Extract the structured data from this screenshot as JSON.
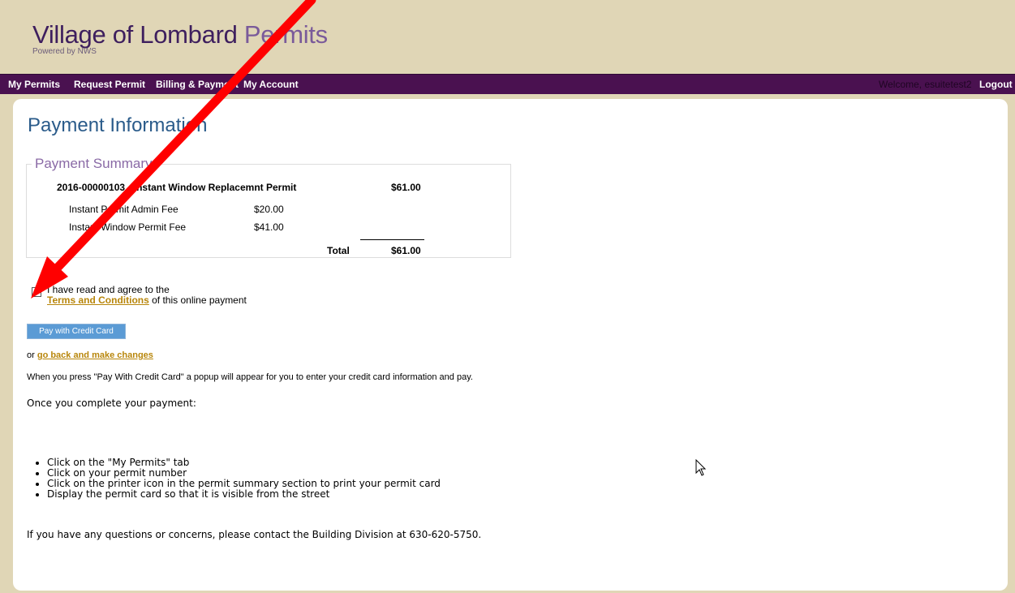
{
  "brand": {
    "title_main": "Village of Lombard",
    "title_accent": "Permits",
    "subtitle": "Powered by NWS"
  },
  "nav": {
    "items": [
      "My Permits",
      "Request Permit",
      "Billing & Payment",
      "My Account"
    ],
    "welcome": "Welcome, esuitetest2",
    "logout": "Logout",
    "bar_color": "#4a1150"
  },
  "page": {
    "title": "Payment Information"
  },
  "summary": {
    "legend": "Payment Summary",
    "permit_line": "2016-00000103 - Instant Window Replacemnt Permit",
    "permit_amount": "$61.00",
    "fees": [
      {
        "name": "Instant Permit Admin Fee",
        "amount": "$20.00"
      },
      {
        "name": "Instant Window Permit Fee",
        "amount": "$41.00"
      }
    ],
    "total_label": "Total",
    "total_amount": "$61.00"
  },
  "agree": {
    "text_before": "I have read and agree to the",
    "link": "Terms and Conditions",
    "text_after": " of this online payment"
  },
  "pay_button": "Pay with Credit Card",
  "back": {
    "prefix": "or ",
    "link": "go back and make changes"
  },
  "popup_note": "When you press \"Pay With Credit Card\" a popup will appear for you to enter your credit card information and pay.",
  "once_complete": "Once you complete your payment:",
  "steps": [
    "Click on the \"My Permits\" tab",
    "Click on your permit number",
    "Click on the printer icon in the permit summary section to print your permit card",
    "Display the permit card so that it is visible from the street"
  ],
  "contact": "If you have any questions or concerns, please contact the Building Division at 630-620-5750.",
  "colors": {
    "accent_arrow": "#ff0000",
    "page_title": "#2a5b8a",
    "link": "#b8860b",
    "button": "#5b9bd5"
  },
  "icons": [
    "mouse-cursor-icon",
    "annotation-arrow-icon"
  ]
}
